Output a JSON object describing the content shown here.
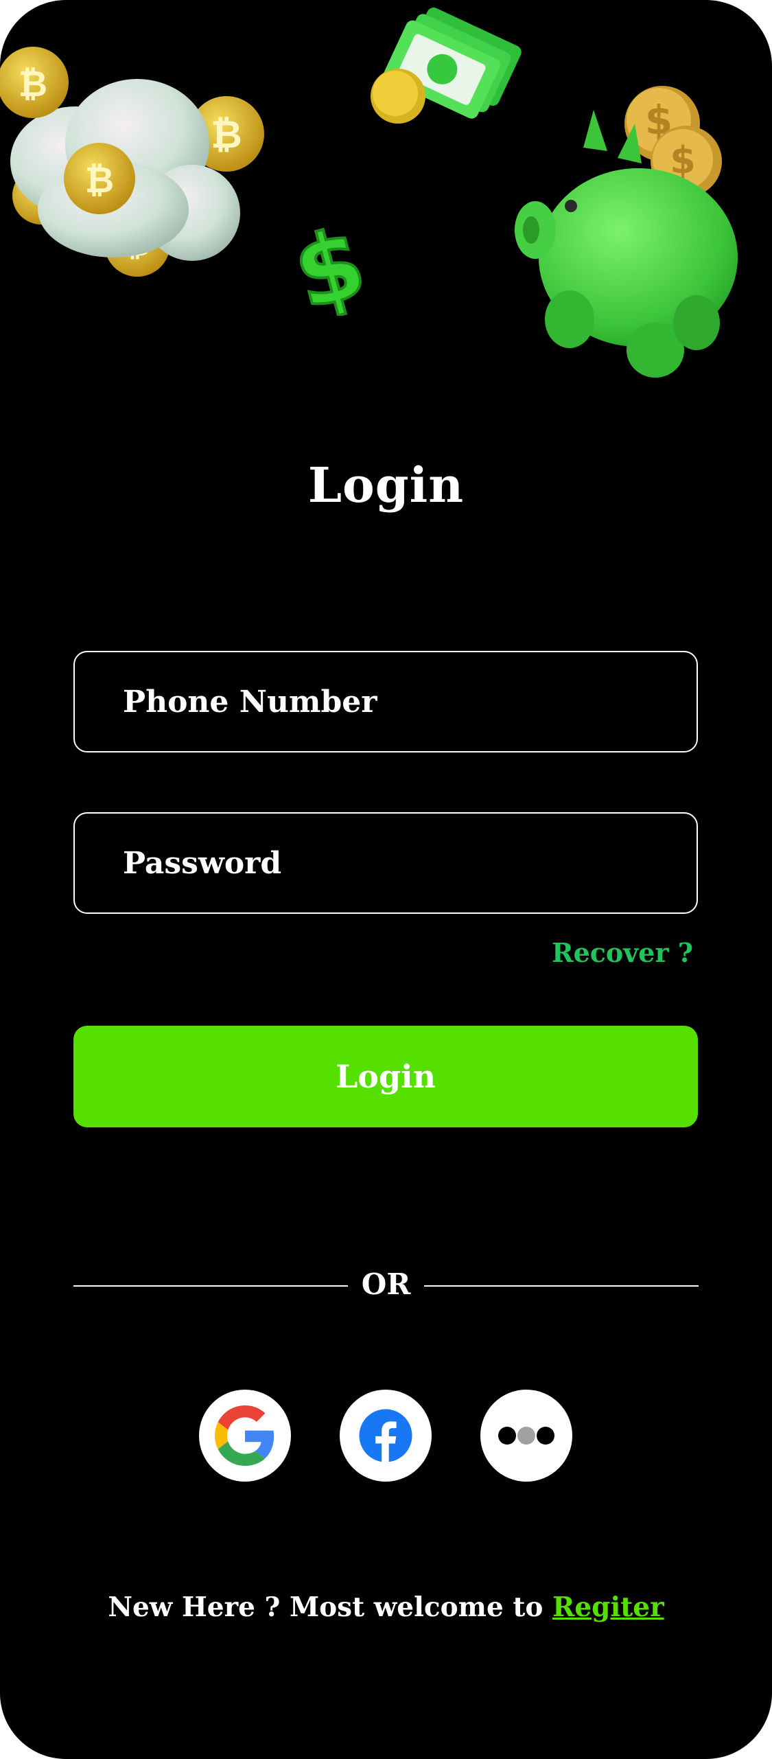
{
  "header": {
    "title": "Login"
  },
  "form": {
    "phone_placeholder": "Phone Number",
    "password_placeholder": "Password",
    "recover_label": "Recover ?",
    "login_label": "Login"
  },
  "divider": {
    "label": "OR"
  },
  "social": [
    {
      "name": "google-icon"
    },
    {
      "name": "facebook-icon"
    },
    {
      "name": "more-dots-icon"
    }
  ],
  "footer": {
    "text": "New Here ? Most welcome to ",
    "register_label": "Regiter"
  },
  "colors": {
    "background": "#000000",
    "accent": "#55e000",
    "recover": "#21c45a",
    "text": "#ffffff"
  },
  "decorations": [
    "bitcoin-coins-cloud",
    "cash-stack",
    "dollar-sign",
    "piggy-bank"
  ]
}
